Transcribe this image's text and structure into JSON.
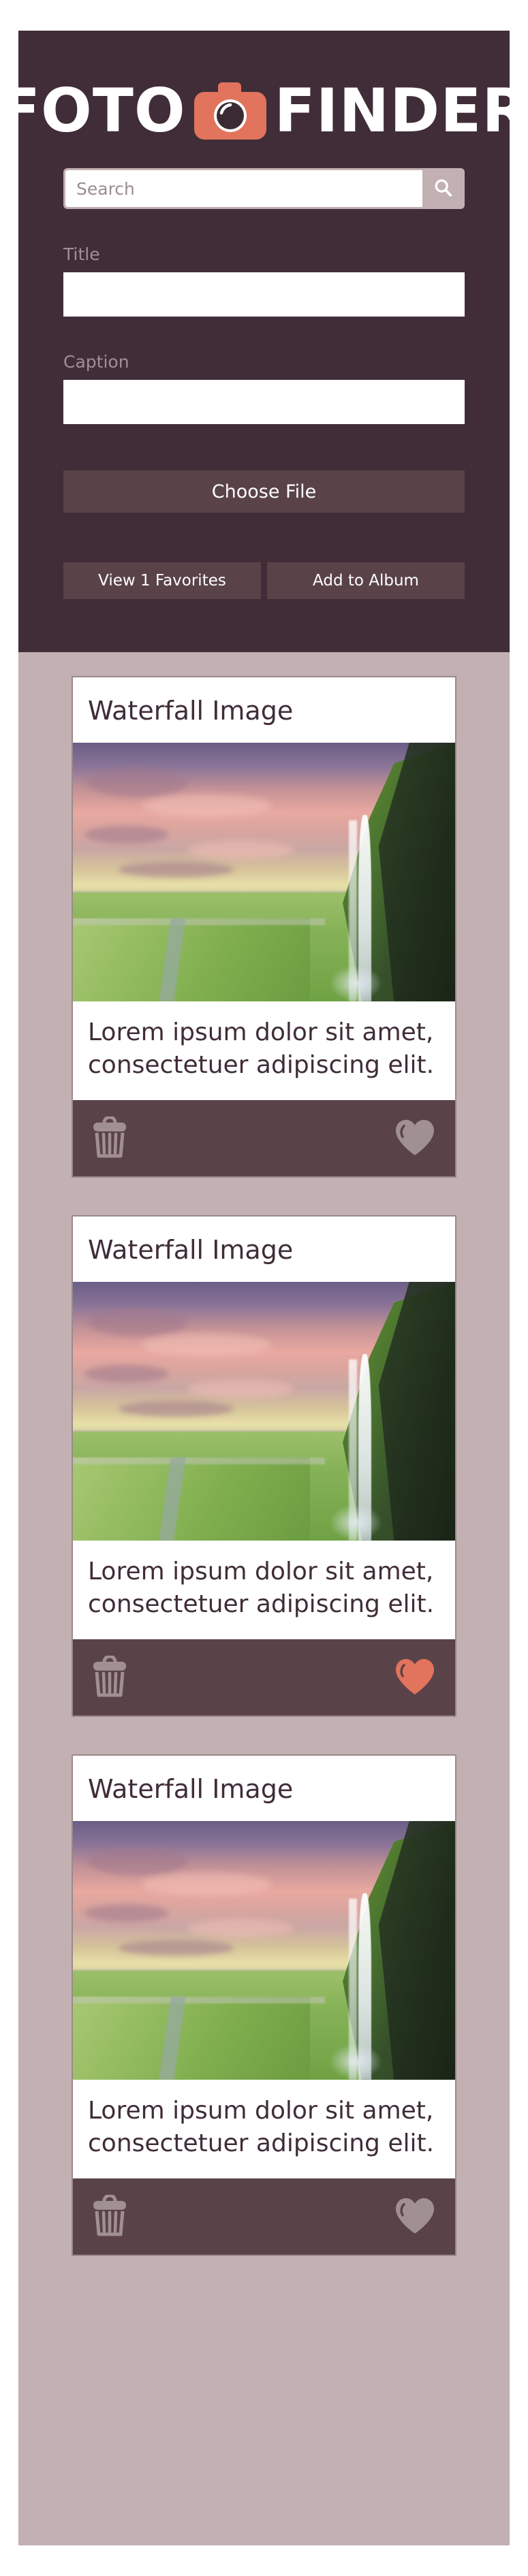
{
  "app": {
    "logo_left": "FOTO",
    "logo_right": "FINDER",
    "logo_icon": "camera-icon"
  },
  "colors": {
    "header_bg": "#402d38",
    "page_bg": "#c2b0b2",
    "accent": "#e2735c",
    "button_bg": "#594349",
    "card_bg": "#ffffff",
    "muted_text": "#a08f93",
    "icon_muted": "#a08f93"
  },
  "search": {
    "value": "",
    "placeholder": "Search",
    "button_icon": "search-icon"
  },
  "form": {
    "title": {
      "label": "Title",
      "value": "",
      "placeholder": ""
    },
    "caption": {
      "label": "Caption",
      "value": "",
      "placeholder": ""
    },
    "choose_file_label": "Choose File",
    "view_favorites_label": "View 1 Favorites",
    "add_to_album_label": "Add to Album"
  },
  "cards": [
    {
      "title": "Waterfall Image",
      "caption": "Lorem ipsum dolor sit amet, consectetuer adipiscing elit.",
      "image_alt": "Waterfall Image",
      "delete_icon": "trash-icon",
      "favorite_icon": "heart-icon",
      "favorited": false
    },
    {
      "title": "Waterfall Image",
      "caption": "Lorem ipsum dolor sit amet, consectetuer adipiscing elit.",
      "image_alt": "Waterfall Image",
      "delete_icon": "trash-icon",
      "favorite_icon": "heart-icon",
      "favorited": true
    },
    {
      "title": "Waterfall Image",
      "caption": "Lorem ipsum dolor sit amet, consectetuer adipiscing elit.",
      "image_alt": "Waterfall Image",
      "delete_icon": "trash-icon",
      "favorite_icon": "heart-icon",
      "favorited": false
    }
  ]
}
